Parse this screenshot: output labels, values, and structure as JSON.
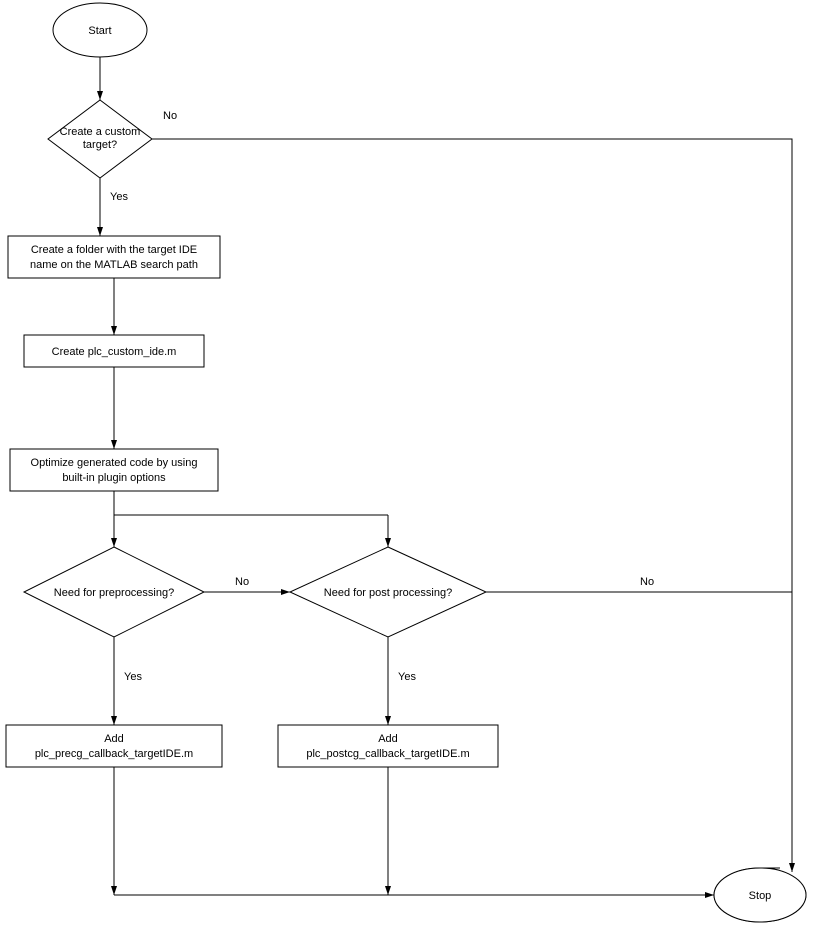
{
  "chart_data": {
    "type": "flowchart",
    "nodes": [
      {
        "id": "start",
        "shape": "ellipse",
        "label": "Start"
      },
      {
        "id": "d1",
        "shape": "decision",
        "label": "Create a custom target?"
      },
      {
        "id": "p1",
        "shape": "process",
        "label": "Create a folder with the target IDE name on the MATLAB search path"
      },
      {
        "id": "p2",
        "shape": "process",
        "label": "Create plc_custom_ide.m"
      },
      {
        "id": "p3",
        "shape": "process",
        "label": "Optimize generated code by using built-in plugin options"
      },
      {
        "id": "d2",
        "shape": "decision",
        "label": "Need for preprocessing?"
      },
      {
        "id": "d3",
        "shape": "decision",
        "label": "Need for post processing?"
      },
      {
        "id": "p4",
        "shape": "process",
        "label": "Add plc_precg_callback_targetIDE.m"
      },
      {
        "id": "p5",
        "shape": "process",
        "label": "Add plc_postcg_callback_targetIDE.m"
      },
      {
        "id": "stop",
        "shape": "ellipse",
        "label": "Stop"
      }
    ],
    "edges": [
      {
        "from": "start",
        "to": "d1"
      },
      {
        "from": "d1",
        "to": "stop",
        "label": "No"
      },
      {
        "from": "d1",
        "to": "p1",
        "label": "Yes"
      },
      {
        "from": "p1",
        "to": "p2"
      },
      {
        "from": "p2",
        "to": "p3"
      },
      {
        "from": "p3",
        "to": "d2"
      },
      {
        "from": "p3",
        "to": "d3"
      },
      {
        "from": "d2",
        "to": "d3",
        "label": "No"
      },
      {
        "from": "d2",
        "to": "p4",
        "label": "Yes"
      },
      {
        "from": "d3",
        "to": "stop",
        "label": "No"
      },
      {
        "from": "d3",
        "to": "p5",
        "label": "Yes"
      },
      {
        "from": "p4",
        "to": "stop"
      },
      {
        "from": "p5",
        "to": "stop"
      }
    ]
  },
  "labels": {
    "start": "Start",
    "d1": "Create a custom\ntarget?",
    "d1_no": "No",
    "d1_yes": "Yes",
    "p1_l1": "Create a folder with the target IDE",
    "p1_l2": "name on the MATLAB search path",
    "p2": "Create plc_custom_ide.m",
    "p3_l1": "Optimize generated code by using",
    "p3_l2": "built-in plugin options",
    "d2": "Need for preprocessing?",
    "d2_no": "No",
    "d2_yes": "Yes",
    "d3": "Need for post processing?",
    "d3_no": "No",
    "d3_yes": "Yes",
    "p4_l1": "Add",
    "p4_l2": "plc_precg_callback_targetIDE.m",
    "p5_l1": "Add",
    "p5_l2": "plc_postcg_callback_targetIDE.m",
    "stop": "Stop"
  }
}
